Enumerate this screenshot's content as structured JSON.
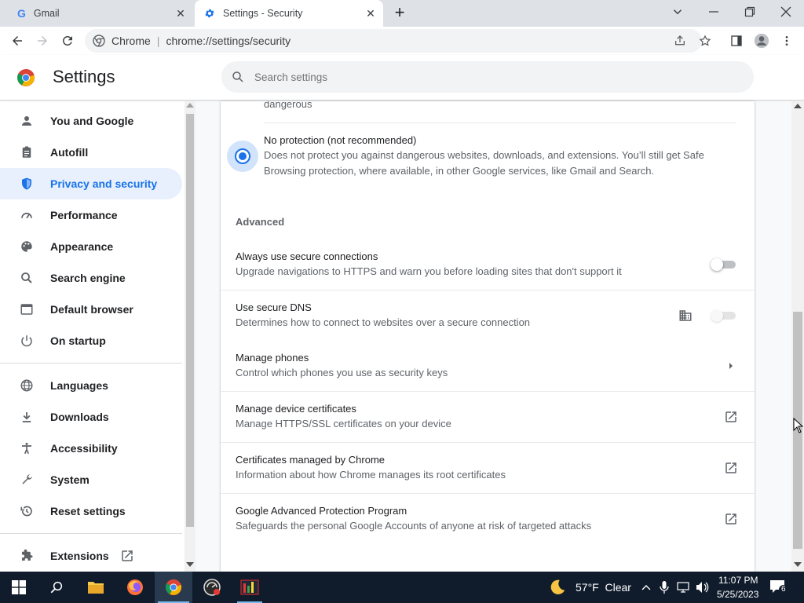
{
  "browser": {
    "tabs": [
      {
        "label": "Gmail",
        "active": false
      },
      {
        "label": "Settings - Security",
        "active": true
      }
    ],
    "omnibox": {
      "site_label": "Chrome",
      "url": "chrome://settings/security"
    }
  },
  "settings": {
    "title": "Settings",
    "search_placeholder": "Search settings"
  },
  "sidebar": {
    "items": [
      {
        "label": "You and Google",
        "icon": "person-icon"
      },
      {
        "label": "Autofill",
        "icon": "clipboard-icon"
      },
      {
        "label": "Privacy and security",
        "icon": "shield-icon",
        "active": true
      },
      {
        "label": "Performance",
        "icon": "speedometer-icon"
      },
      {
        "label": "Appearance",
        "icon": "palette-icon"
      },
      {
        "label": "Search engine",
        "icon": "search-icon"
      },
      {
        "label": "Default browser",
        "icon": "browser-window-icon"
      },
      {
        "label": "On startup",
        "icon": "power-icon"
      },
      {
        "label": "Languages",
        "icon": "globe-icon"
      },
      {
        "label": "Downloads",
        "icon": "download-icon"
      },
      {
        "label": "Accessibility",
        "icon": "accessibility-icon"
      },
      {
        "label": "System",
        "icon": "wrench-icon"
      },
      {
        "label": "Reset settings",
        "icon": "history-icon"
      }
    ],
    "extensions_label": "Extensions"
  },
  "content": {
    "prev_option_tail": "dangerous",
    "no_protection": {
      "title": "No protection (not recommended)",
      "desc_line1": "Does not protect you against dangerous websites, downloads, and extensions. You’ll still get Safe",
      "desc_line2": "Browsing protection, where available, in other Google services, like Gmail and Search."
    },
    "advanced_heading": "Advanced",
    "rows": {
      "https": {
        "title": "Always use secure connections",
        "sub": "Upgrade navigations to HTTPS and warn you before loading sites that don't support it"
      },
      "dns": {
        "title": "Use secure DNS",
        "sub": "Determines how to connect to websites over a secure connection"
      },
      "phones": {
        "title": "Manage phones",
        "sub": "Control which phones you use as security keys"
      },
      "certs": {
        "title": "Manage device certificates",
        "sub": "Manage HTTPS/SSL certificates on your device"
      },
      "chrome_certs": {
        "title": "Certificates managed by Chrome",
        "sub": "Information about how Chrome manages its root certificates"
      },
      "gapp": {
        "title": "Google Advanced Protection Program",
        "sub": "Safeguards the personal Google Accounts of anyone at risk of targeted attacks"
      }
    }
  },
  "taskbar": {
    "weather": "57°F  Clear",
    "time": "11:07 PM",
    "date": "5/25/2023",
    "notifications": "6"
  },
  "colors": {
    "accent": "#1a73e8",
    "active_bg": "#e8f0fe",
    "taskbar": "#101c2c"
  }
}
